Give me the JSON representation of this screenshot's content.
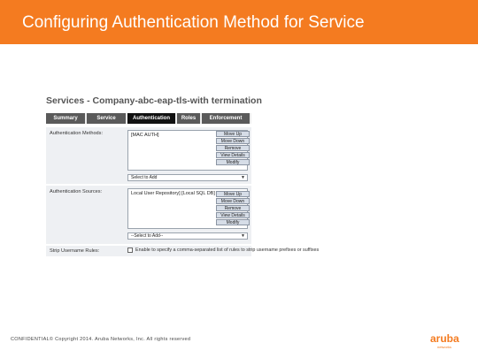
{
  "slide": {
    "title": "Configuring Authentication Method for Service"
  },
  "panel": {
    "title": "Services - Company-abc-eap-tls-with termination",
    "tabs": [
      {
        "label": "Summary"
      },
      {
        "label": "Service"
      },
      {
        "label": "Authentication"
      },
      {
        "label": "Roles"
      },
      {
        "label": "Enforcement"
      }
    ],
    "auth_methods": {
      "label": "Authentication Methods:",
      "items": [
        "[MAC AUTH]"
      ],
      "select_value": "Select to Add",
      "buttons": [
        "Move Up",
        "Move Down",
        "Remove",
        "View Details",
        "Modify"
      ]
    },
    "auth_sources": {
      "label": "Authentication Sources:",
      "items": [
        "Local User Repository] [Local SQL DB]"
      ],
      "select_value": "--Select to Add--",
      "buttons": [
        "Move Up",
        "Move Down",
        "Remove",
        "View Details",
        "Modify"
      ]
    },
    "strip": {
      "label": "Strip Username Rules:",
      "text": "Enable to specify a comma-separated list of rules to strip username prefixes or suffixes"
    }
  },
  "footer": {
    "text": "CONFIDENTIAL© Copyright 2014. Aruba Networks, Inc. All rights reserved"
  },
  "logo": {
    "word": "aruba",
    "sub": "networks"
  },
  "colors": {
    "accent": "#f47b20",
    "tab_dark": "#111111",
    "row_bg": "#eef0f3"
  }
}
